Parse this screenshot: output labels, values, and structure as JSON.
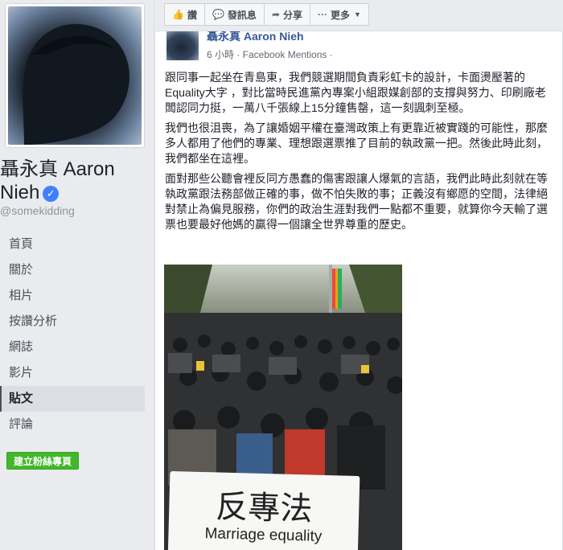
{
  "profile": {
    "name": "聶永真 Aaron Nieh",
    "handle": "@somekidding"
  },
  "nav": {
    "items": [
      {
        "label": "首頁"
      },
      {
        "label": "關於"
      },
      {
        "label": "相片"
      },
      {
        "label": "按讚分析"
      },
      {
        "label": "網誌"
      },
      {
        "label": "影片"
      },
      {
        "label": "貼文"
      },
      {
        "label": "評論"
      }
    ],
    "active_index": 6,
    "create_page_label": "建立粉絲專頁"
  },
  "actions": {
    "like": "讚",
    "message": "發訊息",
    "share": "分享",
    "more": "更多"
  },
  "post": {
    "author": "聶永真 Aaron Nieh",
    "meta": "6 小時 · Facebook Mentions ·",
    "paragraphs": [
      "跟同事一起坐在青島東，我們競選期間負責彩虹卡的設計，卡面燙壓著的Equality大字 ，對比當時民進黨內專案小組跟媒創部的支撐與努力、印刷廠老闆認同力挺，一萬八千張線上15分鐘售罄，這一刻諷刺至極。",
      "我們也很沮喪，為了讓婚姻平權在臺灣政策上有更靠近被實踐的可能性，那麼多人都用了他們的專業、理想跟選票推了目前的執政黨一把。然後此時此刻，我們都坐在這裡。",
      "面對那些公聽會裡反同方愚蠢的傷害跟讓人爆氣的言語，我們此時此刻就在等執政黨跟法務部做正確的事，做不怕失敗的事；正義沒有鄉愿的空間，法律絕對禁止為偏見服務，你們的政治生涯對我們一點都不重要，就算你今天輸了選票也要最好他媽的贏得一個讓全世界尊重的歷史。"
    ],
    "photo": {
      "sign_zh": "反專法",
      "sign_en": "Marriage equality"
    }
  },
  "colors": {
    "link": "#365899",
    "green_button": "#42b72a",
    "verified": "#4080ff"
  }
}
